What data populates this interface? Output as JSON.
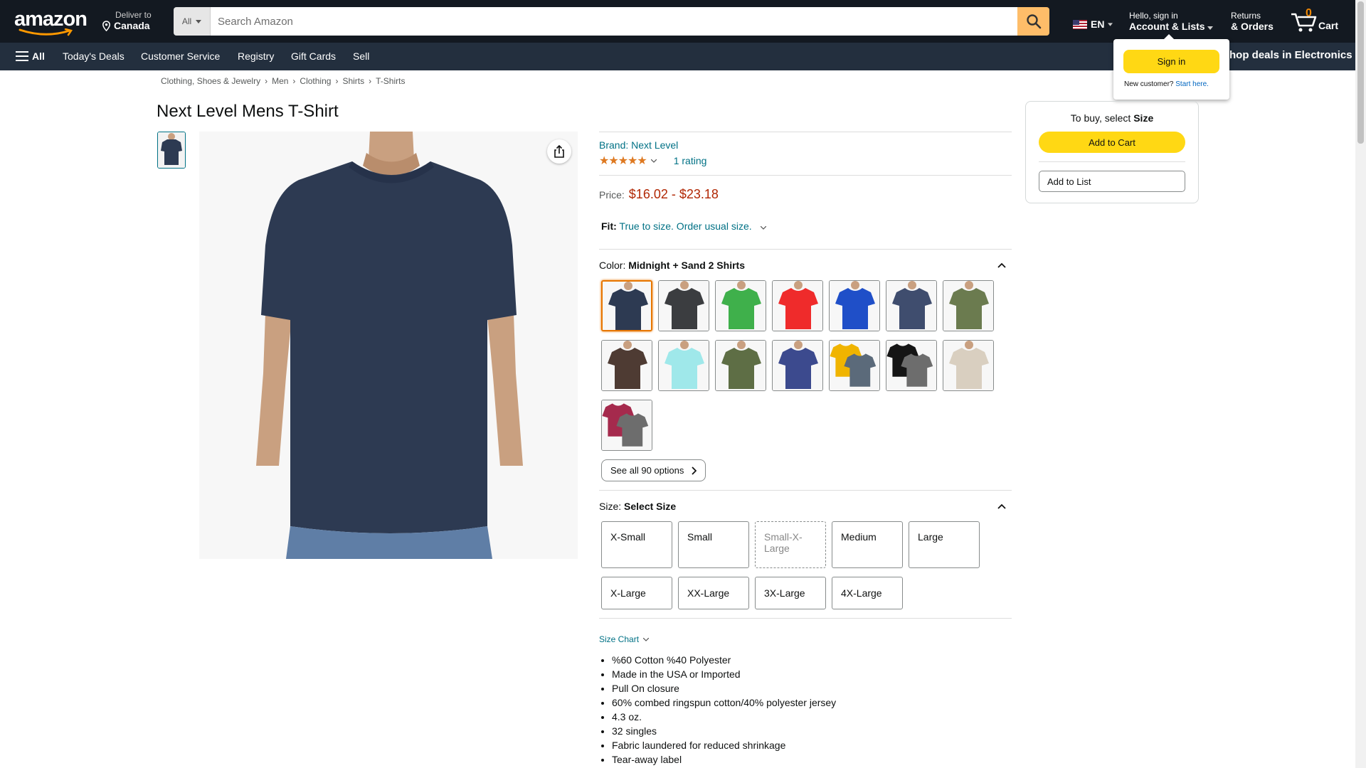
{
  "header": {
    "logo_text": "amazon",
    "deliver_line1": "Deliver to",
    "deliver_line2": "Canada",
    "search_category": "All",
    "search_placeholder": "Search Amazon",
    "language": "EN",
    "account_line1": "Hello, sign in",
    "account_line2": "Account & Lists",
    "returns_line1": "Returns",
    "returns_line2": "& Orders",
    "cart_count": "0",
    "cart_label": "Cart"
  },
  "nav": {
    "all": "All",
    "links": [
      "Today's Deals",
      "Customer Service",
      "Registry",
      "Gift Cards",
      "Sell"
    ],
    "promo": "Shop deals in Electronics"
  },
  "signin_flyout": {
    "button": "Sign in",
    "new_customer": "New customer?",
    "start_here": "Start here."
  },
  "breadcrumb": [
    "Clothing, Shoes & Jewelry",
    "Men",
    "Clothing",
    "Shirts",
    "T-Shirts"
  ],
  "product": {
    "title": "Next Level Mens T-Shirt",
    "brand": "Brand: Next Level",
    "stars": "★★★★★",
    "rating_count": "1 rating",
    "price_label": "Price:",
    "price": "$16.02 - $23.18",
    "fit_label": "Fit:",
    "fit_value": "True to size. Order usual size.",
    "color_label": "Color:",
    "color_value": "Midnight + Sand 2 Shirts",
    "see_all": "See all 90 options",
    "size_label": "Size:",
    "size_value": "Select Size",
    "size_chart": "Size Chart",
    "bullets": [
      "%60 Cotton %40 Polyester",
      "Made in the USA or Imported",
      "Pull On closure",
      "60% combed ringspun cotton/40% polyester jersey",
      "4.3 oz.",
      "32 singles",
      "Fabric laundered for reduced shrinkage",
      "Tear-away label"
    ]
  },
  "swatches": [
    {
      "color": "#2d3a52",
      "selected": true
    },
    {
      "color": "#3b3d40"
    },
    {
      "color": "#3fb04b"
    },
    {
      "color": "#ef2b2b"
    },
    {
      "color": "#1f4fc8"
    },
    {
      "color": "#3f4d6e"
    },
    {
      "color": "#6b7b4f"
    },
    {
      "color": "#4e3b33"
    },
    {
      "color": "#9fe8ea"
    },
    {
      "color": "#5e6e45"
    },
    {
      "color": "#3c4a8e"
    },
    {
      "color": "#f0b400",
      "color2": "#5b6a7a"
    },
    {
      "color": "#151515",
      "color2": "#6d6d6d"
    },
    {
      "color": "#d9cfc0"
    },
    {
      "color": "#a52a4d",
      "color2": "#6d6d6d"
    }
  ],
  "sizes": [
    {
      "label": "X-Small"
    },
    {
      "label": "Small"
    },
    {
      "label": "Small-X-Large",
      "unavailable": true
    },
    {
      "label": "Medium"
    },
    {
      "label": "Large"
    },
    {
      "label": "X-Large"
    },
    {
      "label": "XX-Large"
    },
    {
      "label": "3X-Large"
    },
    {
      "label": "4X-Large"
    }
  ],
  "buybox": {
    "prompt": "To buy, select",
    "prompt_bold": "Size",
    "add_to_cart": "Add to Cart",
    "add_to_list": "Add to List"
  },
  "colors": {
    "header_bg": "#131921",
    "nav_bg": "#232f3e",
    "accent_yellow": "#ffd814",
    "search_button": "#febd69",
    "link": "#007185",
    "price": "#b12704"
  }
}
